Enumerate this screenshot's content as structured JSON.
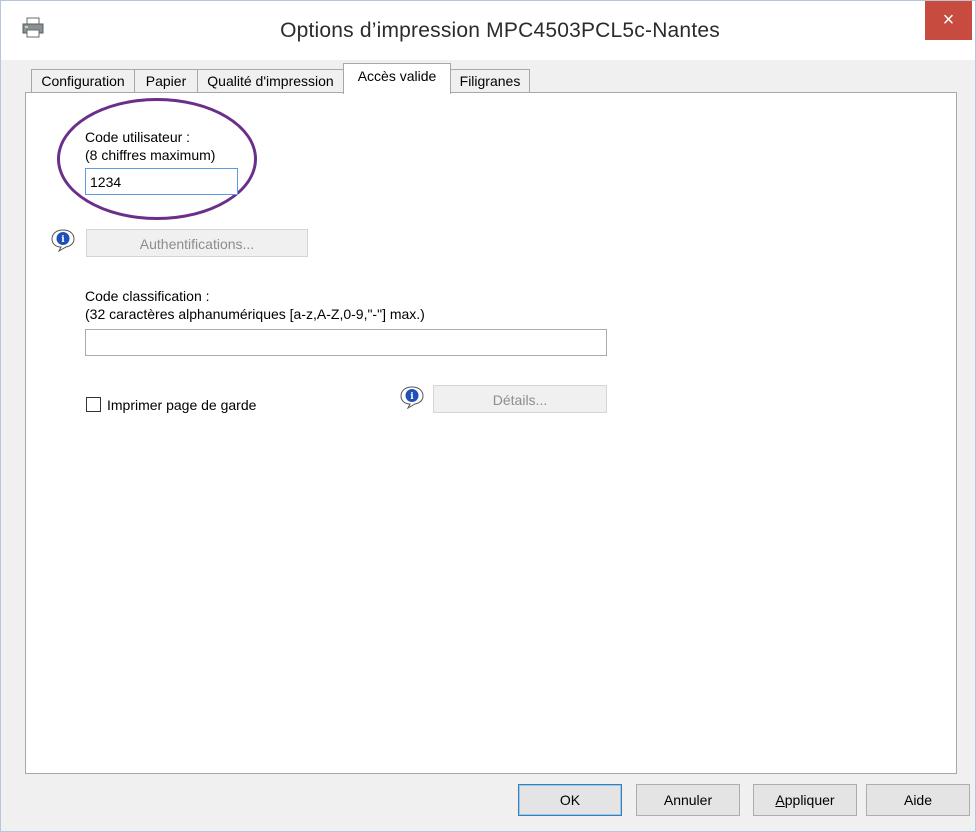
{
  "window": {
    "title": "Options d’impression MPC4503PCL5c-Nantes",
    "close_glyph": "×",
    "app_icon": "printer-icon"
  },
  "tabs": [
    {
      "label": "Configuration",
      "active": false
    },
    {
      "label": "Papier",
      "active": false
    },
    {
      "label": "Qualité d'impression",
      "active": false
    },
    {
      "label": "Accès valide",
      "active": true
    },
    {
      "label": "Filigranes",
      "active": false
    }
  ],
  "user_code": {
    "label_line1": "Code utilisateur :",
    "label_line2": "(8 chiffres maximum)",
    "value": "1234"
  },
  "auth": {
    "info_icon": "info-balloon-icon",
    "button_label": "Authentifications..."
  },
  "classification": {
    "label_line1": "Code classification :",
    "label_line2": "(32 caractères alphanumériques [a-z,A-Z,0-9,\"-\"] max.)",
    "value": ""
  },
  "cover_page": {
    "checkbox_label": "Imprimer page de garde",
    "checked": false,
    "info_icon": "info-balloon-icon",
    "details_label": "Détails..."
  },
  "footer": {
    "ok": "OK",
    "cancel": "Annuler",
    "apply_prefix": "A",
    "apply_rest": "ppliquer",
    "help": "Aide"
  },
  "colors": {
    "highlight": "#6b2f8a",
    "close_button": "#c74b3e",
    "focus_border": "#5b9ddf"
  }
}
